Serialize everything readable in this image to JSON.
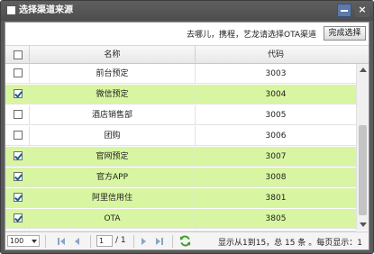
{
  "dialog": {
    "title": "选择渠道来源",
    "close_glyph": "×"
  },
  "toolbar": {
    "tip": "去哪儿，携程，艺龙请选择OTA渠道",
    "done_label": "完成选择"
  },
  "grid": {
    "columns": {
      "name": "名称",
      "code": "代码"
    },
    "rows": [
      {
        "name": "前台预定",
        "code": "3003",
        "checked": false
      },
      {
        "name": "微信预定",
        "code": "3004",
        "checked": true
      },
      {
        "name": "酒店销售部",
        "code": "3005",
        "checked": false
      },
      {
        "name": "团购",
        "code": "3006",
        "checked": false
      },
      {
        "name": "官网预定",
        "code": "3007",
        "checked": true
      },
      {
        "name": "官方APP",
        "code": "3008",
        "checked": true
      },
      {
        "name": "阿里信用住",
        "code": "3801",
        "checked": true
      },
      {
        "name": "OTA",
        "code": "3805",
        "checked": true
      },
      {
        "name": "",
        "code": "",
        "checked": false
      }
    ],
    "selected_row_color": "#d8f5a2"
  },
  "pager": {
    "page_size": "100",
    "current_page": "1",
    "total_pages": "/ 1",
    "info": "显示从1到15，总 15 条 。每页显示：1"
  },
  "colors": {
    "title_bar": "#555555",
    "accent": "#5d7aa8",
    "selected_row": "#d8f5a2"
  }
}
